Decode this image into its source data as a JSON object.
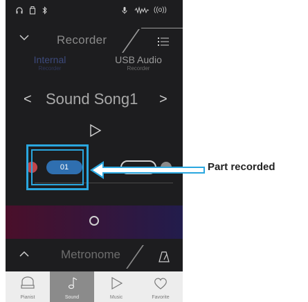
{
  "status_bar": {
    "icons": [
      "headphones-icon",
      "usb-memory-icon",
      "bluetooth-icon",
      "microphone-icon",
      "waveform-icon",
      "wireless-icon"
    ],
    "wireless_text": "((o))"
  },
  "header": {
    "title": "Recorder",
    "back_icon": "chevron-down-icon",
    "menu_icon": "list-menu-icon"
  },
  "tabs": [
    {
      "label": "Internal",
      "sub": "Recorder",
      "active": true
    },
    {
      "label": "USB Audio",
      "sub": "Recorder",
      "active": false
    }
  ],
  "song": {
    "name": "Sound Song1",
    "prev": "<",
    "next": ">"
  },
  "parts": {
    "active_part_label": "01"
  },
  "metronome": {
    "title": "Metronome"
  },
  "bottom_nav": [
    {
      "label": "Pianist",
      "icon": "piano-icon",
      "active": false
    },
    {
      "label": "Sound",
      "icon": "music-note-icon",
      "active": true
    },
    {
      "label": "Music",
      "icon": "play-icon",
      "active": false
    },
    {
      "label": "Favorite",
      "icon": "heart-icon",
      "active": false
    }
  ],
  "callout": {
    "label": "Part recorded"
  },
  "colors": {
    "highlight": "#2aa7df",
    "part_pill": "#2f6fb0",
    "record_dot": "#c0454b"
  }
}
